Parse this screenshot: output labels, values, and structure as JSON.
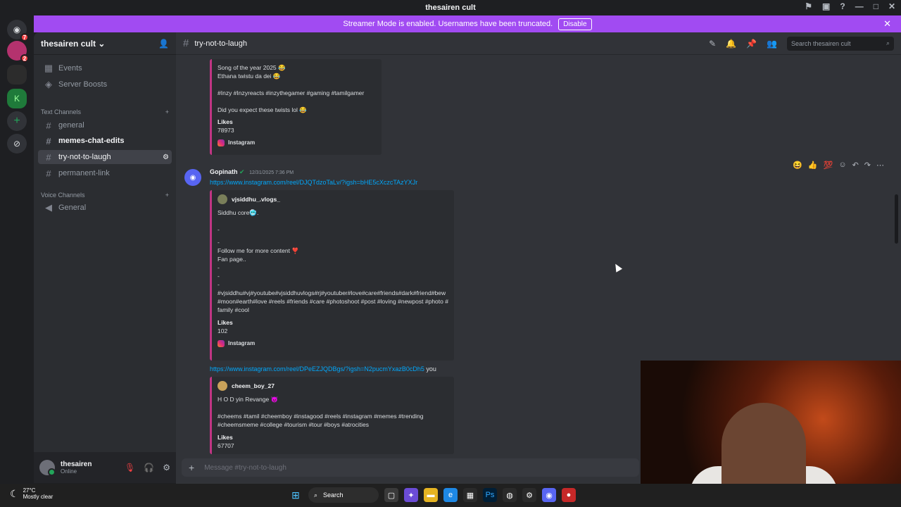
{
  "window": {
    "title": "thesairen cult"
  },
  "banner": {
    "text": "Streamer Mode is enabled. Usernames have been truncated.",
    "button": "Disable"
  },
  "guilds": {
    "dm_badge": "7",
    "server_badge": "2"
  },
  "server": {
    "name": "thesairen cult",
    "items": [
      {
        "label": "Events",
        "icon": "calendar-icon"
      },
      {
        "label": "Server Boosts",
        "icon": "boost-icon"
      }
    ],
    "text_category": "Text Channels",
    "text_channels": [
      "general",
      "memes-chat-edits",
      "try-not-to-laugh",
      "permanent-link"
    ],
    "voice_category": "Voice Channels",
    "voice_channels": [
      "General"
    ]
  },
  "user": {
    "name": "thesairen",
    "status": "Online"
  },
  "channel": {
    "name": "try-not-to-laugh",
    "search_placeholder": "Search thesairen cult"
  },
  "messages": {
    "embed1": {
      "line1": "Song of the year 2025 😂",
      "line2": "Ethana twistu da dei 😂",
      "tags": "#Inzy #Inzyreacts #inzythegamer #gaming #tamilgamer",
      "question": "Did you expect these twists lol 😂",
      "likes_label": "Likes",
      "likes": "78973",
      "provider": "Instagram"
    },
    "msg2": {
      "author": "Gopinath",
      "timestamp": "12/31/2025 7:36 PM",
      "link": "https://www.instagram.com/reel/DJQTdzoTaLv/?igsh=bHE5cXczcTAzYXJr",
      "embed_author": "vjsiddhu_.vlogs_",
      "caption": "Siddhu core🥶.",
      "line_dash1": "-",
      "line_dash2": "-",
      "follow": "Follow me for more content ❣️",
      "fanpage": "Fan page..",
      "line_dash3": "-",
      "line_dash4": "-",
      "line_dash5": "-",
      "tags": "#vjsiddhu#vj#youtube#vjsiddhuvlogs#rj#youtuber#love#care#friends#dark#friend#bew#moon#earth#love #reels #friends #care #photoshoot #post #loving #newpost #photo #family #cool",
      "likes_label": "Likes",
      "likes": "102",
      "provider": "Instagram"
    },
    "msg3": {
      "link": "https://www.instagram.com/reel/DPeEZJQDBgs/?igsh=N2pucmYxazB0cDh5",
      "suffix": "you",
      "embed_author": "cheem_boy_27",
      "caption": "H O D yin Revange 😈",
      "tags": "#cheems #tamil #cheemboy #instagood #reels #instagram #memes #trending #cheemsmeme #college #tourism #tour #boys #atrocities",
      "likes_label": "Likes",
      "likes": "67707"
    }
  },
  "composer": {
    "placeholder": "Message #try-not-to-laugh"
  },
  "taskbar": {
    "temp": "27°C",
    "weather": "Mostly clear",
    "search": "Search"
  },
  "colors": {
    "banner": "#a14bf2",
    "link": "#00a8fc",
    "embed_border": "#c13584"
  }
}
